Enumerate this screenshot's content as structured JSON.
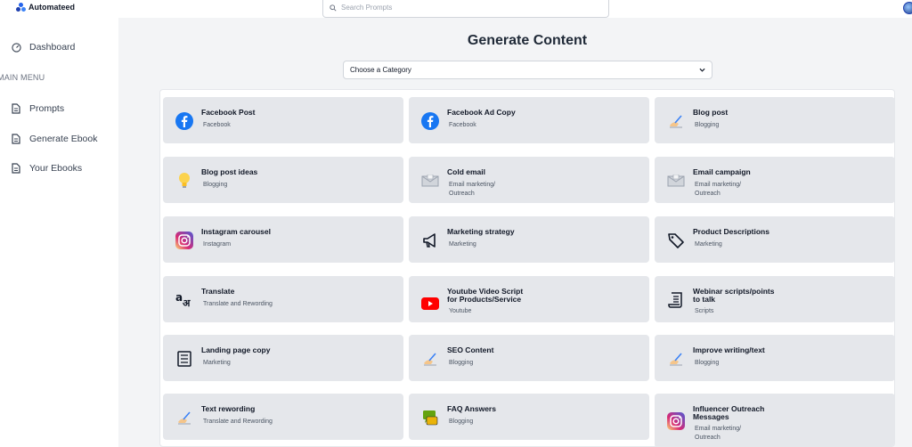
{
  "app": {
    "name": "Automateed"
  },
  "search": {
    "placeholder": "Search Prompts"
  },
  "sidebar": {
    "dashboard": "Dashboard",
    "menu_heading": "MAIN MENU",
    "items": [
      {
        "label": "Prompts"
      },
      {
        "label": "Generate Ebook"
      },
      {
        "label": "Your Ebooks"
      }
    ]
  },
  "main": {
    "title": "Generate Content",
    "category_select": "Choose a Category"
  },
  "cards": [
    {
      "title": "Facebook Post",
      "subtitle": "Facebook",
      "icon": "facebook-icon"
    },
    {
      "title": "Facebook Ad Copy",
      "subtitle": "Facebook",
      "icon": "facebook-icon"
    },
    {
      "title": "Blog post",
      "subtitle": "Blogging",
      "icon": "writing-hand-icon"
    },
    {
      "title": "Blog post ideas",
      "subtitle": "Blogging",
      "icon": "lightbulb-icon"
    },
    {
      "title": "Cold email",
      "subtitle": "Email marketing/\nOutreach",
      "icon": "envelope-icon"
    },
    {
      "title": "Email campaign",
      "subtitle": "Email marketing/\nOutreach",
      "icon": "envelope-icon"
    },
    {
      "title": "Instagram carousel",
      "subtitle": "Instagram",
      "icon": "instagram-icon"
    },
    {
      "title": "Marketing strategy",
      "subtitle": "Marketing",
      "icon": "megaphone-icon"
    },
    {
      "title": "Product Descriptions",
      "subtitle": "Marketing",
      "icon": "tag-icon"
    },
    {
      "title": "Translate",
      "subtitle": "Translate and Rewording",
      "icon": "translate-icon"
    },
    {
      "title": "Youtube Video Script\nfor Products/Service",
      "subtitle": "Youtube",
      "icon": "youtube-icon"
    },
    {
      "title": "Webinar scripts/points\nto talk",
      "subtitle": "Scripts",
      "icon": "script-icon"
    },
    {
      "title": "Landing page copy",
      "subtitle": "Marketing",
      "icon": "list-page-icon"
    },
    {
      "title": "SEO Content",
      "subtitle": "Blogging",
      "icon": "writing-hand-icon"
    },
    {
      "title": "Improve writing/text",
      "subtitle": "Blogging",
      "icon": "writing-hand-icon"
    },
    {
      "title": "Text rewording",
      "subtitle": "Translate and Rewording",
      "icon": "writing-hand-icon"
    },
    {
      "title": "FAQ Answers",
      "subtitle": "Blogging",
      "icon": "faq-icon"
    },
    {
      "title": "Influencer Outreach\nMessages",
      "subtitle": "Email marketing/\nOutreach",
      "icon": "instagram-icon"
    }
  ],
  "colors": {
    "facebook": "#1877f2",
    "youtube": "#ff0000",
    "background": "#f3f4f6",
    "card": "#e5e7eb"
  }
}
